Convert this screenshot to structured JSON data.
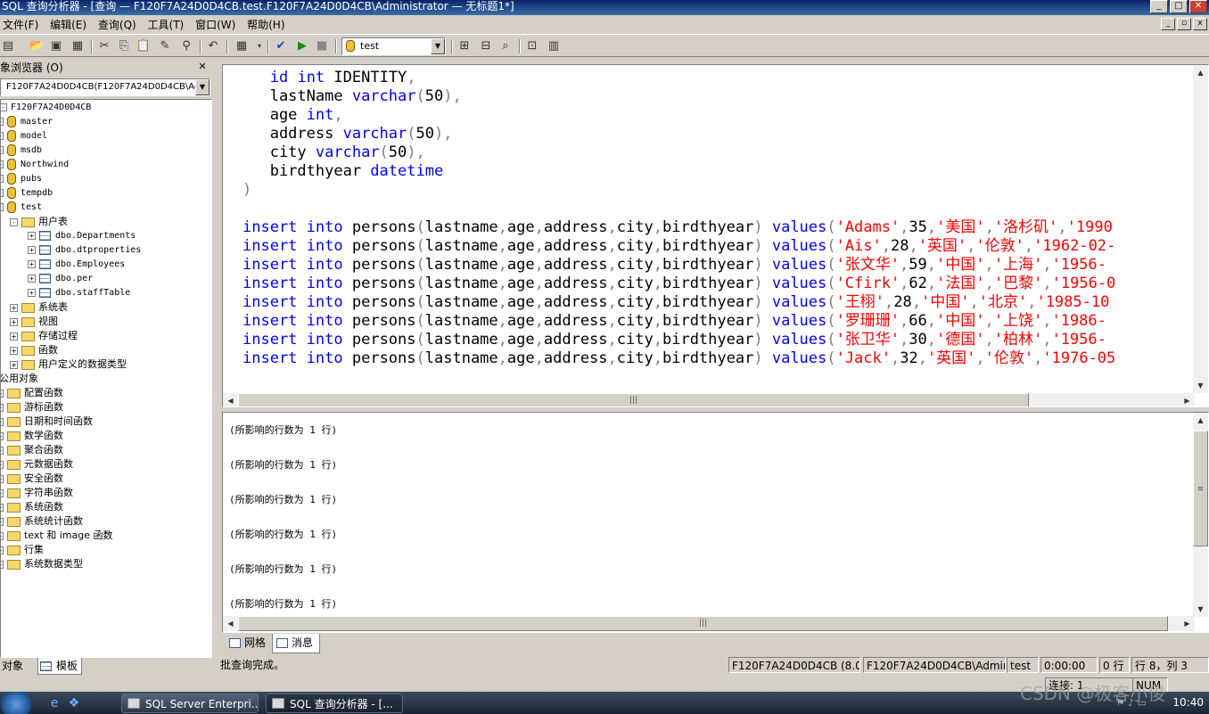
{
  "window": {
    "title": "SQL 查询分析器 - [查询 — F120F7A24D0D4CB.test.F120F7A24D0D4CB\\Administrator — 无标题1*]"
  },
  "menu": [
    "文件(F)",
    "编辑(E)",
    "查询(Q)",
    "工具(T)",
    "窗口(W)",
    "帮助(H)"
  ],
  "toolbar": {
    "database": "test"
  },
  "object_browser": {
    "title": "对象浏览器 (O)",
    "server_select": "F120F7A24D0D4CB(F120F7A24D0D4CB\\Administrator)",
    "server": "F120F7A24D0D4CB",
    "databases": [
      "master",
      "model",
      "msdb",
      "Northwind",
      "pubs",
      "tempdb",
      "test"
    ],
    "test_user_tables_label": "用户表",
    "tables": [
      "dbo.Departments",
      "dbo.dtproperties",
      "dbo.Employees",
      "dbo.per",
      "dbo.staffTable"
    ],
    "test_nodes": [
      "系统表",
      "视图",
      "存储过程",
      "函数",
      "用户定义的数据类型"
    ],
    "common_objects": "公用对象",
    "function_groups": [
      "配置函数",
      "游标函数",
      "日期和时间函数",
      "数学函数",
      "聚合函数",
      "元数据函数",
      "安全函数",
      "字符串函数",
      "系统函数",
      "系统统计函数",
      "text 和 image 函数",
      "行集",
      "系统数据类型"
    ],
    "tabs": [
      "对象",
      "模板"
    ]
  },
  "editor": {
    "insert_rows": [
      {
        "name": "Adams",
        "age": "35",
        "address": "美国",
        "city": "洛杉矶",
        "year": "1990"
      },
      {
        "name": "Ais",
        "age": "28",
        "address": "英国",
        "city": "伦敦",
        "year": "1962-02-"
      },
      {
        "name": "张文华",
        "age": "59",
        "address": "中国",
        "city": "上海",
        "year": "1956-"
      },
      {
        "name": "Cfirk",
        "age": "62",
        "address": "法国",
        "city": "巴黎",
        "year": "1956-0"
      },
      {
        "name": "王栩",
        "age": "28",
        "address": "中国",
        "city": "北京",
        "year": "1985-10"
      },
      {
        "name": "罗珊珊",
        "age": "66",
        "address": "中国",
        "city": "上饶",
        "year": "1986-"
      },
      {
        "name": "张卫华",
        "age": "30",
        "address": "德国",
        "city": "柏林",
        "year": "1956-"
      },
      {
        "name": "Jack",
        "age": "32",
        "address": "英国",
        "city": "伦敦",
        "year": "1976-05"
      }
    ]
  },
  "results": {
    "messages": [
      "(所影响的行数为 1 行)",
      "(所影响的行数为 1 行)",
      "(所影响的行数为 1 行)",
      "(所影响的行数为 1 行)",
      "(所影响的行数为 1 行)",
      "(所影响的行数为 1 行)"
    ],
    "tabs": [
      "网格",
      "消息"
    ]
  },
  "status": {
    "message": "批查询完成。",
    "server": "F120F7A24D0D4CB (8.0)",
    "user": "F120F7A24D0D4CB\\Administrator",
    "db": "test",
    "time": "0:00:00",
    "rows": "0 行",
    "position": "行 8，列 3",
    "connections": "连接: 1",
    "num": "NUM"
  },
  "taskbar": {
    "tasks": [
      "SQL Server Enterpri...",
      "SQL 查询分析器 - [..."
    ],
    "clock": "10:40"
  },
  "watermark": "CSDN @极客小俊"
}
